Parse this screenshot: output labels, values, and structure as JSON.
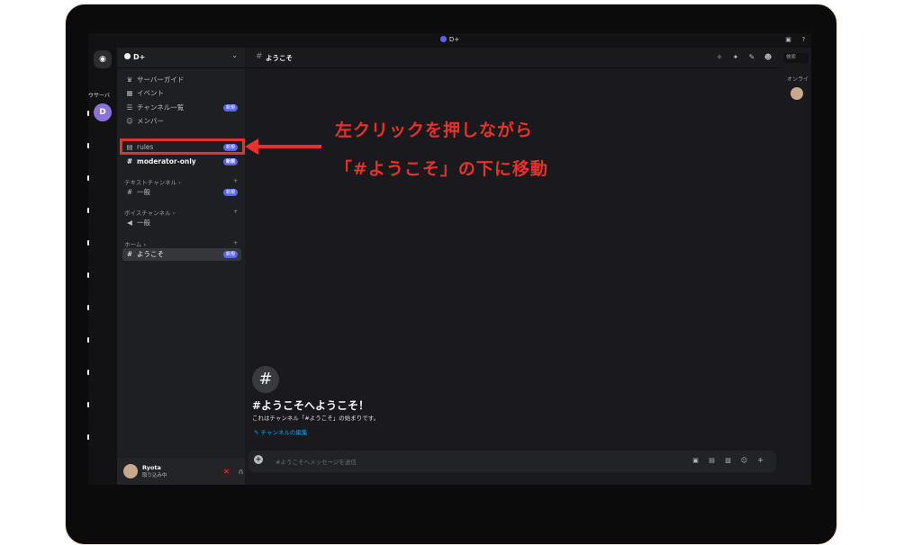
{
  "window": {
    "title": "D+"
  },
  "server_rail": {
    "label": "ウサーバ",
    "server_initial": "D"
  },
  "server": {
    "name": "D+"
  },
  "top_items": [
    {
      "icon": "trophy-icon",
      "glyph": "🏆",
      "label": "サーバーガイド"
    },
    {
      "icon": "calendar-icon",
      "glyph": "▦",
      "label": "イベント"
    },
    {
      "icon": "channel-list-icon",
      "glyph": "☰",
      "label": "チャンネル一覧",
      "badge": "新規"
    },
    {
      "icon": "members-icon",
      "glyph": "👥",
      "label": "メンバー"
    }
  ],
  "channels": {
    "rules": {
      "label": "rules",
      "badge": "新規"
    },
    "moderator": {
      "label": "moderator-only",
      "badge": "新規"
    },
    "text_category": "テキストチャンネル",
    "text_general": {
      "label": "一般",
      "badge": "新規"
    },
    "voice_category": "ボイスチャンネル",
    "voice_general": {
      "label": "一般"
    },
    "home_category": "ホーム",
    "welcome": {
      "label": "ようこそ",
      "badge": "新規"
    }
  },
  "user": {
    "name": "Ryota",
    "status": "取り込み中"
  },
  "main": {
    "channel_name": "ようこそ",
    "welcome_title": "#ようこそへようこそ！",
    "welcome_sub": "これはチャンネル「#ようこそ」の始まりです。",
    "edit_link": "チャンネルの編集",
    "composer_placeholder": "#ようこそへメッセージを送信",
    "search_placeholder": "検索"
  },
  "members": {
    "online_label": "オンライ"
  },
  "annotation": {
    "line1": "左クリックを押しながら",
    "line2": "「#ようこそ」の下に移動"
  },
  "colors": {
    "accent": "#5865f2",
    "annotation": "#e8312a"
  }
}
